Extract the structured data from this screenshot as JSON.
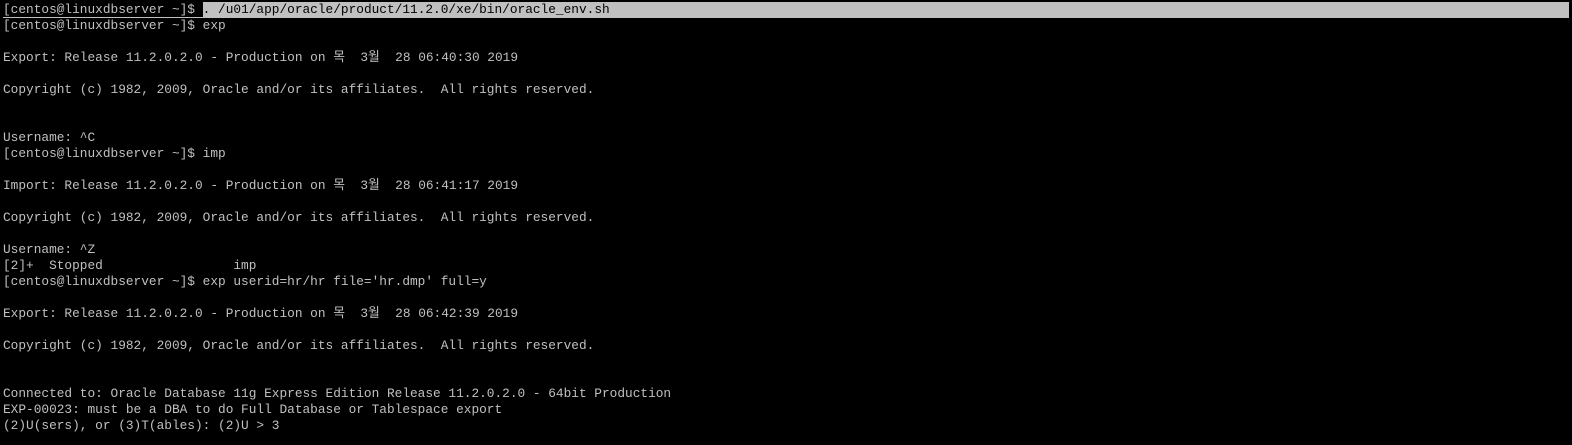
{
  "terminal": {
    "colors": {
      "background": "#000000",
      "foreground": "#c0c0c0",
      "selection": "#c0c0c0"
    },
    "selected_line": {
      "prompt": "[centos@linuxdbserver ~]$ ",
      "command": ". /u01/app/oracle/product/11.2.0/xe/bin/oracle_env.sh"
    },
    "lines": [
      "[centos@linuxdbserver ~]$ exp",
      "",
      "Export: Release 11.2.0.2.0 - Production on 목  3월  28 06:40:30 2019",
      "",
      "Copyright (c) 1982, 2009, Oracle and/or its affiliates.  All rights reserved.",
      "",
      "",
      "Username: ^C",
      "[centos@linuxdbserver ~]$ imp",
      "",
      "Import: Release 11.2.0.2.0 - Production on 목  3월  28 06:41:17 2019",
      "",
      "Copyright (c) 1982, 2009, Oracle and/or its affiliates.  All rights reserved.",
      "",
      "Username: ^Z",
      "[2]+  Stopped                 imp",
      "[centos@linuxdbserver ~]$ exp userid=hr/hr file='hr.dmp' full=y",
      "",
      "Export: Release 11.2.0.2.0 - Production on 목  3월  28 06:42:39 2019",
      "",
      "Copyright (c) 1982, 2009, Oracle and/or its affiliates.  All rights reserved.",
      "",
      "",
      "Connected to: Oracle Database 11g Express Edition Release 11.2.0.2.0 - 64bit Production",
      "EXP-00023: must be a DBA to do Full Database or Tablespace export",
      "(2)U(sers), or (3)T(ables): (2)U > 3"
    ]
  }
}
